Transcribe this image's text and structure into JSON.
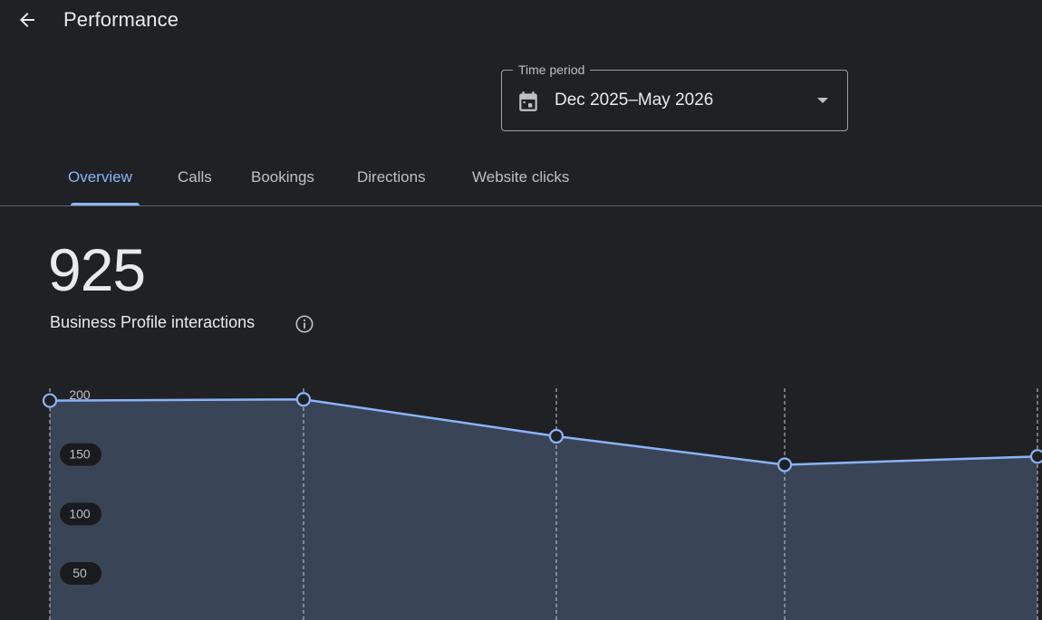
{
  "header": {
    "title": "Performance",
    "back_icon": "arrow-back-icon"
  },
  "time_period": {
    "label": "Time period",
    "value": "Dec 2025–May 2026",
    "calendar_icon": "calendar-icon",
    "dropdown_icon": "dropdown-arrow-icon"
  },
  "tabs": [
    {
      "label": "Overview",
      "active": true
    },
    {
      "label": "Calls",
      "active": false
    },
    {
      "label": "Bookings",
      "active": false
    },
    {
      "label": "Directions",
      "active": false
    },
    {
      "label": "Website clicks",
      "active": false
    }
  ],
  "summary": {
    "total": "925",
    "label": "Business Profile interactions",
    "info_icon": "info-icon"
  },
  "colors": {
    "background": "#202124",
    "accent": "#8ab4f8",
    "area_fill": "#3a4457"
  },
  "chart_data": {
    "type": "area",
    "x": [
      0,
      1,
      2,
      3,
      4
    ],
    "values": [
      195,
      196,
      165,
      141,
      148
    ],
    "y_ticks": [
      "200",
      "150",
      "100",
      "50"
    ],
    "y_tick_values": [
      200,
      150,
      100,
      50
    ],
    "ylim": [
      0,
      200
    ],
    "grid": true
  }
}
